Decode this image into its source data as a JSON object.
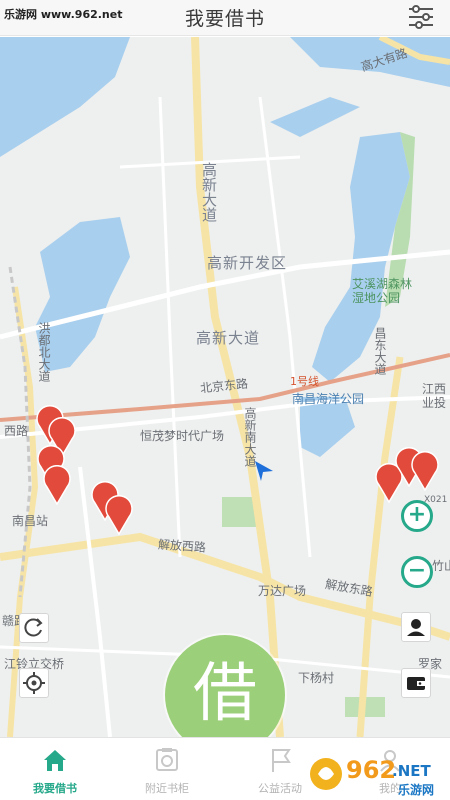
{
  "watermark_top": "乐游网 www.962.net",
  "app_title": "我要借书",
  "borrow_button": "借",
  "map": {
    "labels": {
      "gaoda_road": "高大有路",
      "gaoxin_ave_v": "高新大道",
      "gaoxin_district": "高新开发区",
      "gaoxin_ave_h": "高新大道",
      "aixi_park": "艾溪湖森林湿地公园",
      "changdong_ave": "昌东大道",
      "hongdu_road": "洪都北大道",
      "beijing_east": "北京东路",
      "metro_line": "1号线",
      "ocean_park": "南昌海洋公园",
      "jiangxi": "江西业投",
      "west_road": "西路",
      "hengmao": "恒茂梦时代广场",
      "gaoxin_south": "高新南大道",
      "nanchang_station": "南昌站",
      "x021": "X021",
      "jiefang_west": "解放西路",
      "jiefang_east": "解放东路",
      "wanda": "万达广场",
      "zhulin": "竹山",
      "ganjiang": "赣路",
      "lingli": "江铃立交桥",
      "luojia": "罗家",
      "xiayang": "下杨村"
    }
  },
  "icons": {
    "menu": "menu-icon",
    "refresh": "refresh-icon",
    "locate": "locate-icon",
    "profile": "profile-icon",
    "wallet": "wallet-icon",
    "zoom_in": "zoom-in-icon",
    "zoom_out": "zoom-out-icon"
  },
  "colors": {
    "accent": "#26a88a",
    "pin": "#e24a3b",
    "borrow": "#9ccf7a",
    "water": "#a9cfee",
    "road": "#f8e8b0"
  },
  "tabs": [
    {
      "label": "我要借书",
      "active": true
    },
    {
      "label": "附近书柜",
      "active": false
    },
    {
      "label": "公益活动",
      "active": false
    },
    {
      "label": "我的",
      "active": false
    }
  ],
  "watermark_logo": {
    "brand": "962",
    "net": ".NET",
    "sub": "乐游网"
  }
}
